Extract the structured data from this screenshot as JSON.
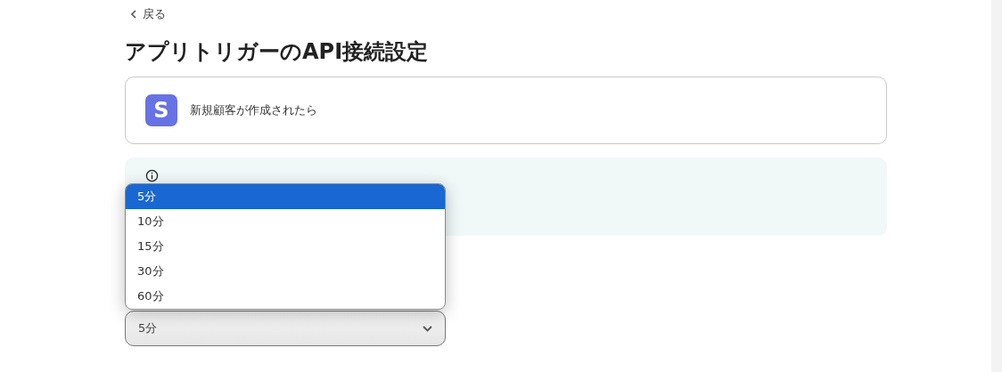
{
  "back_link": {
    "label": "戻る"
  },
  "title": "アプリトリガーのAPI接続設定",
  "trigger_card": {
    "app_initial": "S",
    "label": "新規顧客が作成されたら"
  },
  "interval_select": {
    "value": "5分",
    "expanded": true,
    "options": [
      {
        "label": "5分",
        "selected": true
      },
      {
        "label": "10分",
        "selected": false
      },
      {
        "label": "15分",
        "selected": false
      },
      {
        "label": "30分",
        "selected": false
      },
      {
        "label": "60分",
        "selected": false
      }
    ]
  }
}
